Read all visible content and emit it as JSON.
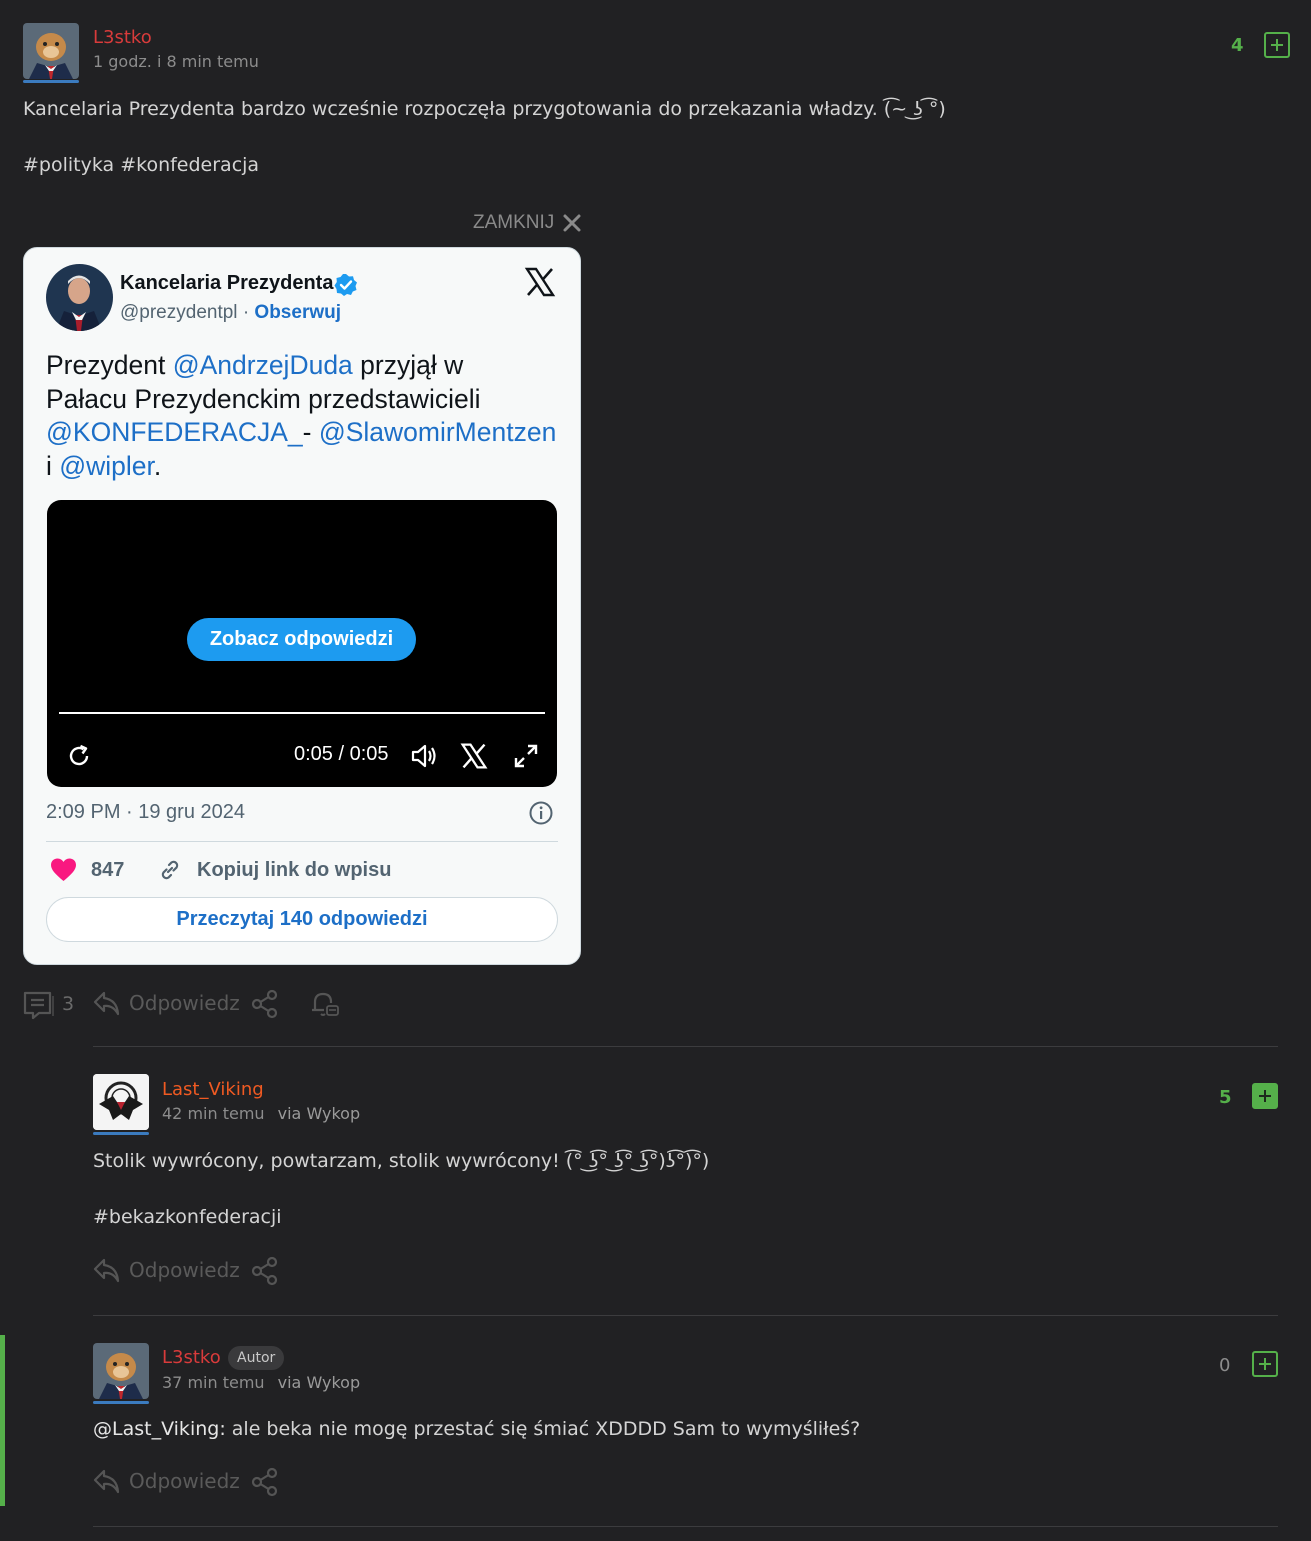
{
  "post": {
    "author": "L3stko",
    "time": "1 godz. i 8 min temu",
    "votes": "4",
    "text": "Kancelaria Prezydenta bardzo wcześnie rozpoczęła przygotowania do przekazania władzy. (͡~ ͜ʖ ͡°)",
    "tags": "#polityka #konfederacja",
    "close_label": "ZAMKNIJ",
    "comments_count": "3",
    "reply_label": "Odpowiedz"
  },
  "tweet": {
    "name": "Kancelaria Prezydenta",
    "handle": "@prezydentpl",
    "follow": "Obserwuj",
    "text_1": "Prezydent ",
    "mention_1": "@AndrzejDuda",
    "text_2": " przyjął w",
    "text_3": "Pałacu Prezydenckim przedstawicieli",
    "mention_2": "@KONFEDERACJA_",
    "text_4": "- ",
    "mention_3": "@SlawomirMentzen",
    "text_5": "i ",
    "mention_4": "@wipler",
    "text_6": ".",
    "video_button": "Zobacz odpowiedzi",
    "video_time": "0:05 / 0:05",
    "video_progress": 1.0,
    "timestamp": "2:09 PM · 19 gru 2024",
    "likes": "847",
    "copy_link": "Kopiuj link do wpisu",
    "read_replies": "Przeczytaj 140 odpowiedzi"
  },
  "comments": [
    {
      "author": "Last_Viking",
      "time": "42 min temu",
      "via": "via Wykop",
      "votes": "5",
      "text": "Stolik wywrócony, powtarzam, stolik wywrócony! (͡° ͜ʖ͡° ͜ʖ͡° ͜ʖ͡°)ʖ͡°)͡°)",
      "tags": "#bekazkonfederacji",
      "reply_label": "Odpowiedz"
    },
    {
      "author": "L3stko",
      "badge": "Autor",
      "time": "37 min temu",
      "via": "via Wykop",
      "votes": "0",
      "mention": "@Last_Viking:",
      "text": " ale beka nie mogę przestać się śmiać XDDDD Sam to wymyśliłeś?",
      "reply_label": "Odpowiedz"
    }
  ],
  "colors": {
    "background": "#212123",
    "author_red": "#d93b3b",
    "author_orange": "#f05a22",
    "vote_green": "#55b04a",
    "tweet_link": "#1d6fc7",
    "tweet_button": "#1d9bf0",
    "like_pink": "#f91880",
    "accent_bar": "#3b7bbf"
  },
  "icons": [
    "plus-icon",
    "close-icon",
    "verified-icon",
    "x-logo-icon",
    "replay-icon",
    "volume-icon",
    "fullscreen-icon",
    "info-icon",
    "heart-icon",
    "link-icon",
    "comments-icon",
    "reply-icon",
    "share-icon",
    "bell-icon"
  ]
}
